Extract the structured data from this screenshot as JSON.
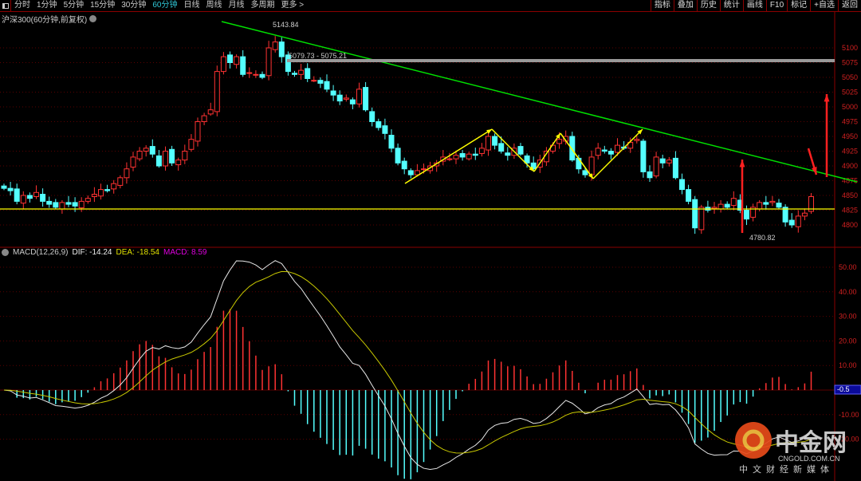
{
  "toolbar": {
    "periods": [
      "分时",
      "1分钟",
      "5分钟",
      "15分钟",
      "30分钟",
      "60分钟",
      "日线",
      "周线",
      "月线",
      "多周期",
      "更多 >"
    ],
    "active": "60分钟",
    "right_buttons": [
      "指标",
      "叠加",
      "历史",
      "统计",
      "画线",
      "F10",
      "标记",
      "+自选",
      "返回"
    ]
  },
  "chart": {
    "title": "沪深300(60分钟,前复权)",
    "price_labels": [
      "5100",
      "5075",
      "5050",
      "5025",
      "5000",
      "4975",
      "4950",
      "4925",
      "4900",
      "4875",
      "4850",
      "4825",
      "4800"
    ],
    "high_label": "5143.84",
    "range_label": "5079.73 - 5075.21",
    "low_label": "4780.82",
    "closes": [
      4862,
      4858,
      4840,
      4850,
      4845,
      4855,
      4840,
      4835,
      4830,
      4838,
      4835,
      4832,
      4840,
      4845,
      4852,
      4860,
      4858,
      4870,
      4880,
      4895,
      4915,
      4925,
      4930,
      4920,
      4900,
      4925,
      4905,
      4910,
      4925,
      4945,
      4975,
      4985,
      4995,
      5060,
      5085,
      5075,
      5085,
      5055,
      5058,
      5055,
      5050,
      5100,
      5110,
      5085,
      5060,
      5055,
      5062,
      5048,
      5045,
      5040,
      5030,
      5020,
      5010,
      5015,
      5005,
      5030,
      4995,
      4975,
      4965,
      4955,
      4930,
      4905,
      4895,
      4885,
      4892,
      4895,
      4900,
      4905,
      4915,
      4912,
      4918,
      4915,
      4920,
      4918,
      4930,
      4950,
      4935,
      4925,
      4918,
      4930,
      4920,
      4905,
      4895,
      4910,
      4925,
      4935,
      4945,
      4950,
      4910,
      4895,
      4885,
      4915,
      4930,
      4925,
      4920,
      4935,
      4930,
      4940,
      4945,
      4890,
      4880,
      4915,
      4905,
      4910,
      4880,
      4860,
      4840,
      4795,
      4830,
      4825,
      4830,
      4835,
      4830,
      4845,
      4825,
      4810,
      4830,
      4838,
      4835,
      4840,
      4830,
      4805,
      4800,
      4815,
      4820,
      4848
    ],
    "colors": {
      "up": "#ff3232",
      "down": "#54ffff",
      "trend": "#00e000",
      "support": "#ffff00",
      "zigzag": "#ffff00",
      "arrow": "#ff2020"
    }
  },
  "macd": {
    "label": "MACD(12,26,9)",
    "dif": "DIF: -14.24",
    "dea": "DEA: -18.54",
    "macd": "MACD: 8.59",
    "axis_labels": [
      "50.00",
      "40.00",
      "30.00",
      "20.00",
      "10.00",
      "-10.00",
      "-20.00"
    ],
    "current_tag": "-0.5"
  },
  "watermark": {
    "brand": "中金网",
    "domain": "CNGOLD.COM.CN",
    "slogan": "中文财经新媒体"
  }
}
